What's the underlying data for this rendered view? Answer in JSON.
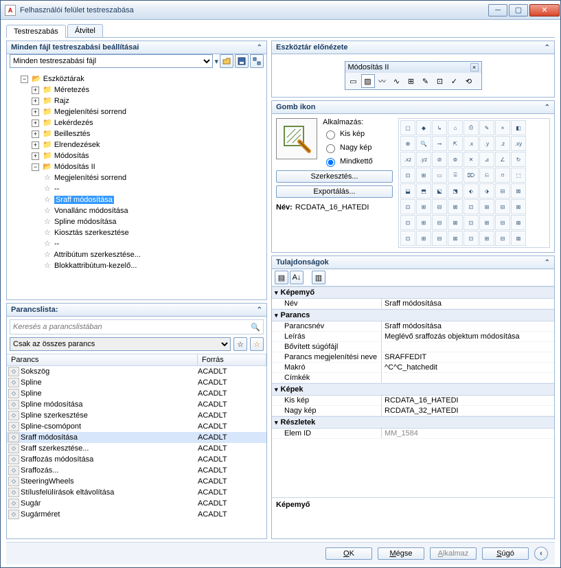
{
  "window": {
    "title": "Felhasználói felület testreszabása"
  },
  "tabs": {
    "customize": "Testreszabás",
    "transfer": "Átvitel"
  },
  "leftTop": {
    "title": "Minden fájl testreszabási beállításai",
    "fileSelect": "Minden testreszabási fájl",
    "tree": {
      "root": "Eszköztárak",
      "branches": [
        "Méretezés",
        "Rajz",
        "Megjelenítési sorrend",
        "Lekérdezés",
        "Beillesztés",
        "Elrendezések",
        "Módosítás"
      ],
      "openBranch": "Módosítás II",
      "leaves": [
        "Megjelenítési sorrend",
        "--",
        "Sraff módosítása",
        "Vonallánc módosítása",
        "Spline módosítása",
        "Kiosztás szerkesztése",
        "--",
        "Attribútum szerkesztése...",
        "Blokkattribútum-kezelő..."
      ],
      "selected": "Sraff módosítása"
    }
  },
  "commandList": {
    "title": "Parancslista:",
    "searchPlaceholder": "Keresés a parancslistában",
    "filter": "Csak az összes parancs",
    "colCmd": "Parancs",
    "colSrc": "Forrás",
    "rows": [
      {
        "name": "Sokszög",
        "src": "ACADLT"
      },
      {
        "name": "Spline",
        "src": "ACADLT"
      },
      {
        "name": "Spline",
        "src": "ACADLT"
      },
      {
        "name": "Spline módosítása",
        "src": "ACADLT"
      },
      {
        "name": "Spline szerkesztése",
        "src": "ACADLT"
      },
      {
        "name": "Spline-csomópont",
        "src": "ACADLT"
      },
      {
        "name": "Sraff módosítása",
        "src": "ACADLT",
        "sel": true
      },
      {
        "name": "Sraff szerkesztése...",
        "src": "ACADLT"
      },
      {
        "name": "Sraffozás módosítása",
        "src": "ACADLT"
      },
      {
        "name": "Sraffozás...",
        "src": "ACADLT"
      },
      {
        "name": "SteeringWheels",
        "src": "ACADLT"
      },
      {
        "name": "Stílusfelülírások eltávolítása",
        "src": "ACADLT"
      },
      {
        "name": "Sugár",
        "src": "ACADLT"
      },
      {
        "name": "Sugárméret",
        "src": "ACADLT"
      }
    ]
  },
  "preview": {
    "title": "Eszköztár előnézete",
    "tbTitle": "Módosítás II"
  },
  "buttonIcon": {
    "title": "Gomb ikon",
    "apply": "Alkalmazás:",
    "small": "Kis kép",
    "large": "Nagy kép",
    "both": "Mindkettő",
    "edit": "Szerkesztés...",
    "export": "Exportálás...",
    "nameLabel": "Név:",
    "nameValue": "RCDATA_16_HATEDI"
  },
  "props": {
    "title": "Tulajdonságok",
    "cat_screen": "Képemyő",
    "k_name": "Név",
    "v_name": "Sraff módosítása",
    "cat_cmd": "Parancs",
    "k_cmdname": "Parancsnév",
    "v_cmdname": "Sraff módosítása",
    "k_desc": "Leírás",
    "v_desc": "Meglévő sraffozás objektum módosítása",
    "k_help": "Bővített súgófájl",
    "v_help": "",
    "k_dispname": "Parancs megjelenítési neve",
    "v_dispname": "SRAFFEDIT",
    "k_macro": "Makró",
    "v_macro": "^C^C_hatchedit",
    "k_tags": "Címkék",
    "v_tags": "",
    "cat_img": "Képek",
    "k_small": "Kis kép",
    "v_small": "RCDATA_16_HATEDI",
    "k_large": "Nagy kép",
    "v_large": "RCDATA_32_HATEDI",
    "cat_det": "Részletek",
    "k_elemid": "Elem ID",
    "v_elemid": "MM_1584",
    "helpTitle": "Képemyő"
  },
  "footer": {
    "ok": "OK",
    "cancel": "Mégse",
    "apply": "Alkalmaz",
    "help": "Súgó"
  },
  "iconlib": [
    "▢",
    "◆",
    "↳",
    "⌂",
    "⎙",
    "✎",
    "×",
    "◧",
    "⊕",
    "🔍",
    "⊸",
    "⇱",
    ".x",
    ".y",
    ".z",
    ".xy",
    ".xz",
    ".yz",
    "⊘",
    "⊚",
    "✕",
    "⊿",
    "∠",
    "↻",
    "⊡",
    "⊞",
    "▭",
    "⍓",
    "⌦",
    "⎌",
    "⌑",
    "⬚",
    "⬓",
    "⬒",
    "⬕",
    "⬔",
    "⬖",
    "⬗",
    "⊟",
    "⊠",
    "⊡",
    "⊞",
    "⊟",
    "⊠",
    "⊡",
    "⊞",
    "⊟",
    "⊠",
    "⊡",
    "⊞",
    "⊟",
    "⊠",
    "⊡",
    "⊞",
    "⊟",
    "⊠",
    "⊡",
    "⊞",
    "⊟",
    "⊠",
    "⊡",
    "⊞",
    "⊟",
    "⊠"
  ]
}
